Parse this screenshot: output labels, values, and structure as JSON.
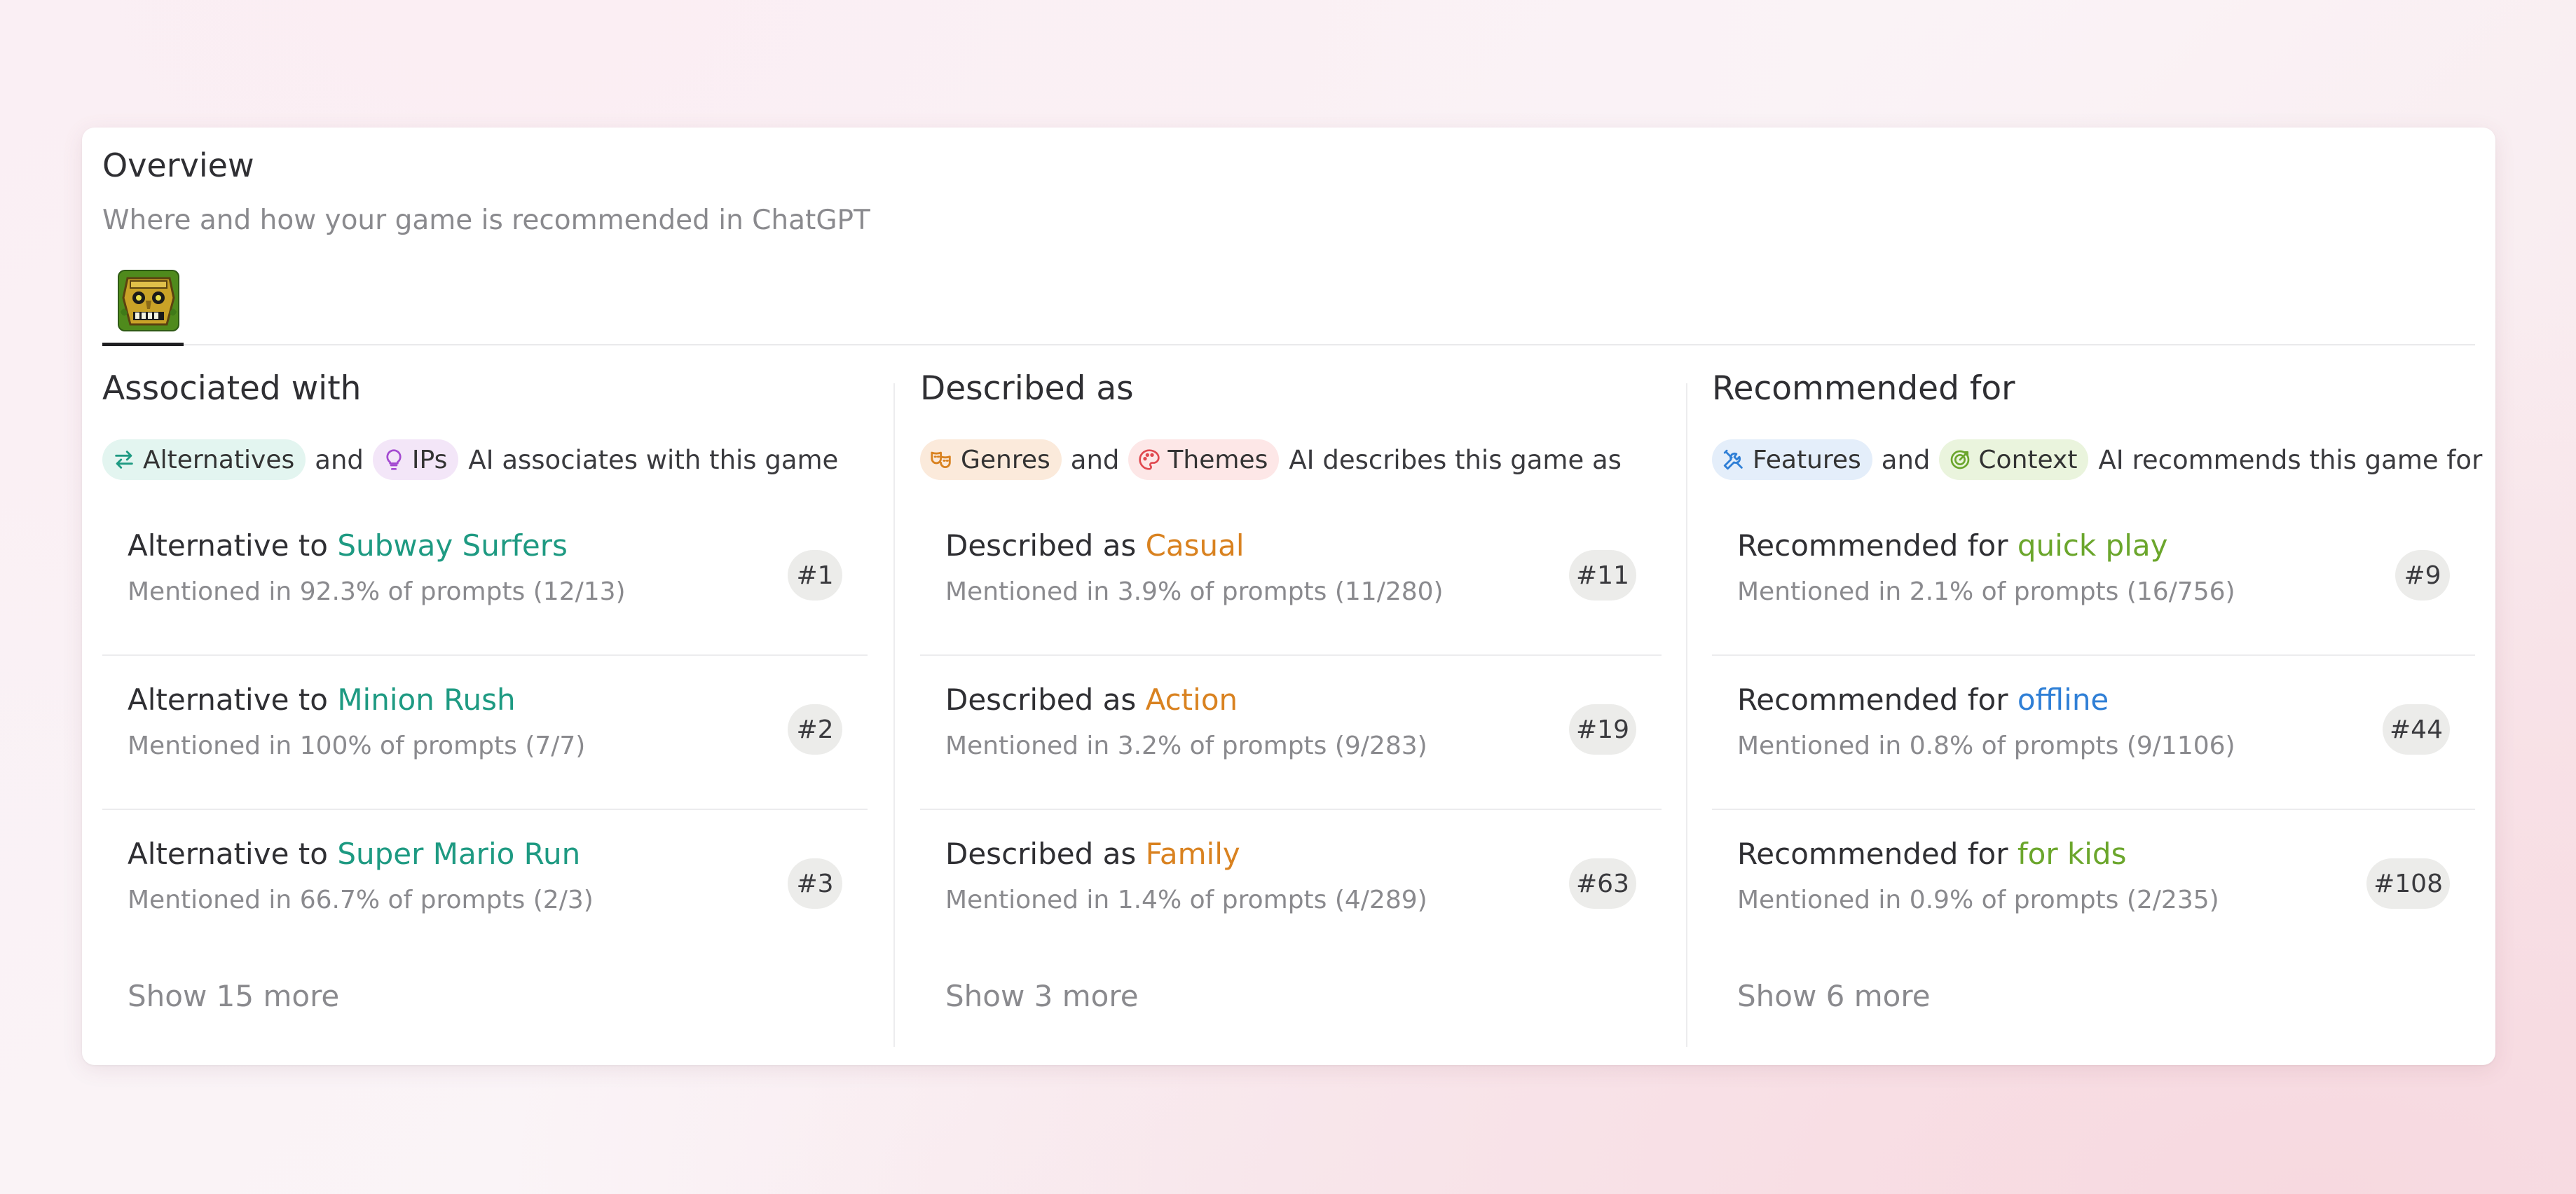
{
  "header": {
    "title": "Overview",
    "subtitle": "Where and how your game is recommended in ChatGPT"
  },
  "tab": {
    "icon": "temple-mask-game-icon"
  },
  "colors": {
    "alternative_link": "#1e9a82",
    "genre_link": "#d98220",
    "feature_link_green": "#6ba62c",
    "feature_link_blue": "#2f7fd6",
    "chip_alternatives_bg": "#e3f5f0",
    "chip_ips_bg": "#f3e6f8",
    "chip_genres_bg": "#fbeadb",
    "chip_themes_bg": "#fde7e7",
    "chip_features_bg": "#e4eefa",
    "chip_context_bg": "#eaf4dd"
  },
  "associated": {
    "title": "Associated with",
    "chip1": "Alternatives",
    "chip2": "IPs",
    "and": "and",
    "tail": "AI associates with this game",
    "rows": [
      {
        "prefix": "Alternative to",
        "name": "Subway Surfers",
        "stat": "Mentioned in 92.3% of prompts (12/13)",
        "rank": "#1"
      },
      {
        "prefix": "Alternative to",
        "name": "Minion Rush",
        "stat": "Mentioned in 100% of prompts (7/7)",
        "rank": "#2"
      },
      {
        "prefix": "Alternative to",
        "name": "Super Mario Run",
        "stat": "Mentioned in 66.7% of prompts (2/3)",
        "rank": "#3"
      }
    ],
    "show_more": "Show 15 more"
  },
  "described": {
    "title": "Described as",
    "chip1": "Genres",
    "chip2": "Themes",
    "and": "and",
    "tail": "AI describes this game as",
    "rows": [
      {
        "prefix": "Described as",
        "name": "Casual",
        "stat": "Mentioned in 3.9% of prompts (11/280)",
        "rank": "#11"
      },
      {
        "prefix": "Described as",
        "name": "Action",
        "stat": "Mentioned in 3.2% of prompts (9/283)",
        "rank": "#19"
      },
      {
        "prefix": "Described as",
        "name": "Family",
        "stat": "Mentioned in 1.4% of prompts (4/289)",
        "rank": "#63"
      }
    ],
    "show_more": "Show 3 more"
  },
  "recommended": {
    "title": "Recommended for",
    "chip1": "Features",
    "chip2": "Context",
    "and": "and",
    "tail": "AI recommends this game for",
    "rows": [
      {
        "prefix": "Recommended for",
        "name": "quick play",
        "stat": "Mentioned in 2.1% of prompts (16/756)",
        "rank": "#9"
      },
      {
        "prefix": "Recommended for",
        "name": "offline",
        "stat": "Mentioned in 0.8% of prompts (9/1106)",
        "rank": "#44"
      },
      {
        "prefix": "Recommended for",
        "name": "for kids",
        "stat": "Mentioned in 0.9% of prompts (2/235)",
        "rank": "#108"
      }
    ],
    "show_more": "Show 6 more"
  }
}
